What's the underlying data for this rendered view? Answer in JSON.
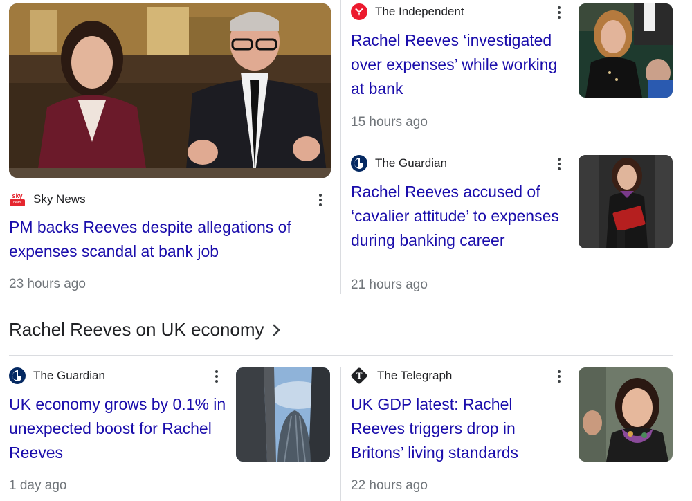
{
  "top_left": {
    "source": "Sky News",
    "headline": "PM backs Reeves despite allegations of expenses scandal at bank job",
    "time": "23 hours ago",
    "logo_badge": "sky",
    "logo_subtext": "news",
    "logo_color": "#e5262f"
  },
  "top_right_1": {
    "source": "The Independent",
    "headline": "Rachel Reeves ‘investigated over expenses’ while working at bank",
    "time": "15 hours ago",
    "logo_color": "#ec1a2e"
  },
  "top_right_2": {
    "source": "The Guardian",
    "headline": "Rachel Reeves accused of ‘cavalier attitude’ to expenses during banking career",
    "time": "21 hours ago",
    "logo_color": "#052962"
  },
  "section": {
    "title": "Rachel Reeves on UK economy"
  },
  "bottom_left": {
    "source": "The Guardian",
    "headline": "UK economy grows by 0.1% in unexpected boost for Rachel Reeves",
    "time": "1 day ago",
    "logo_color": "#052962"
  },
  "bottom_right": {
    "source": "The Telegraph",
    "headline": "UK GDP latest: Rachel Reeves triggers drop in Britons’ living standards",
    "time": "22 hours ago",
    "logo_color": "#202124"
  },
  "colors": {
    "headline": "#1a0dab",
    "meta": "#70757a",
    "divider": "#dadce0"
  }
}
